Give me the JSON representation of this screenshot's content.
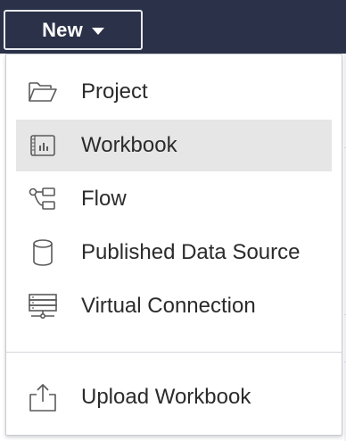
{
  "toolbar": {
    "new_button_label": "New",
    "new_button_icon": "caret-down-icon"
  },
  "menu": {
    "items": [
      {
        "label": "Project",
        "icon": "folder-open-icon",
        "selected": false
      },
      {
        "label": "Workbook",
        "icon": "workbook-icon",
        "selected": true
      },
      {
        "label": "Flow",
        "icon": "flow-icon",
        "selected": false
      },
      {
        "label": "Published Data Source",
        "icon": "database-icon",
        "selected": false
      },
      {
        "label": "Virtual Connection",
        "icon": "virtual-connection-icon",
        "selected": false
      }
    ],
    "upload": {
      "label": "Upload Workbook",
      "icon": "upload-icon"
    }
  },
  "colors": {
    "topbar": "#2b3148",
    "selected_item_bg": "#e6e6e6",
    "icon_stroke": "#5a5a5a",
    "text": "#2b2b2b"
  }
}
